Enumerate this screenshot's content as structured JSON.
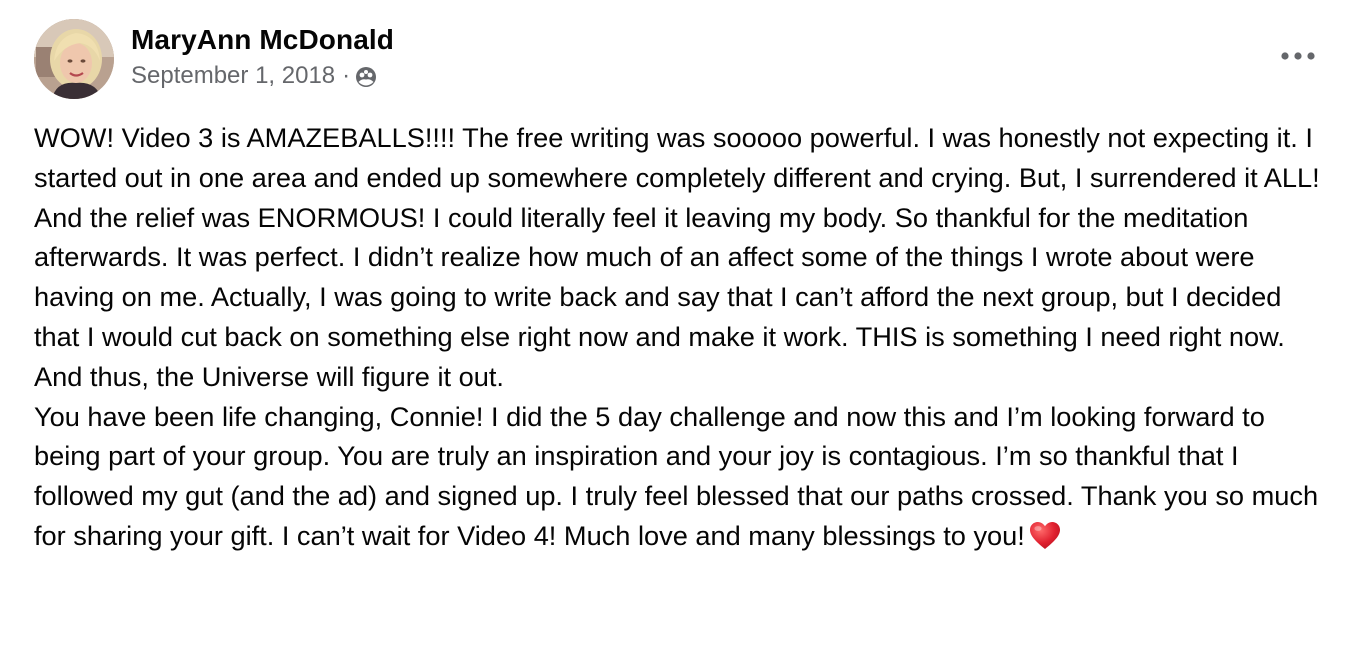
{
  "post": {
    "author_name": "MaryAnn McDonald",
    "date": "September 1, 2018",
    "separator": "·",
    "audience_icon": "public-globe-icon",
    "more_icon": "more-options-icon",
    "paragraphs": [
      "WOW! Video 3 is AMAZEBALLS!!!! The free writing was sooooo powerful. I was honestly not expecting it. I started out in one area and ended up somewhere completely different and crying. But, I surrendered it ALL! And the relief was ENORMOUS! I could literally feel it leaving my body. So thankful for the meditation afterwards. It was perfect. I didn’t realize how much of an affect some of the things I wrote about were having on me. Actually, I was going to write back and say that I can’t afford the next group, but I decided that I would cut back on something else right now and make it work. THIS is something I need right now. And thus, the Universe will figure it out.",
      "You have been life changing, Connie! I did the 5 day challenge and now this and I’m looking forward to being part of your group. You are truly an inspiration and your joy is contagious. I’m so thankful that I followed my gut (and the ad) and signed up. I truly feel blessed that our paths crossed. Thank you so much for sharing your gift. I can’t wait for Video 4! Much love and many blessings to you!"
    ],
    "trailing_emoji": "red-heart-icon"
  },
  "colors": {
    "text_primary": "#050505",
    "text_secondary": "#65676b",
    "heart_red": "#e0202f",
    "background": "#ffffff"
  }
}
